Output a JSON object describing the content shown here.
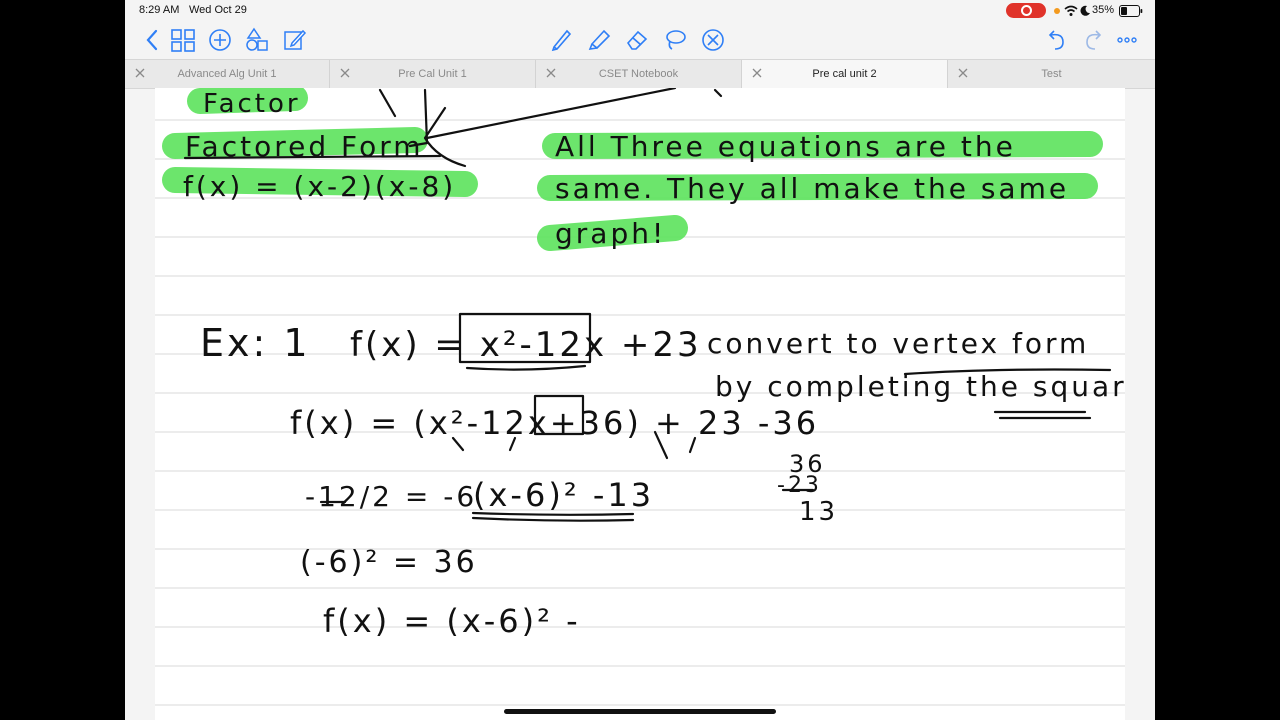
{
  "status": {
    "time": "8:29 AM",
    "date": "Wed Oct 29",
    "battery": "35%"
  },
  "toolbar": {
    "left_icons": [
      "back-chevron-icon",
      "thumbnails-grid-icon",
      "add-circle-icon",
      "shapes-icon",
      "edit-document-icon"
    ],
    "center_tools": [
      "pen-icon",
      "highlighter-icon",
      "eraser-icon",
      "lasso-icon",
      "close-tools-icon"
    ],
    "right_icons": [
      "undo-icon",
      "redo-icon",
      "more-icon"
    ],
    "pen_color": "#111111",
    "highlighter_color": "#5fe35f",
    "accent": "#2f7ff6"
  },
  "tabs": [
    {
      "label": "Advanced Alg Unit 1",
      "active": false
    },
    {
      "label": "Pre Cal Unit 1",
      "active": false
    },
    {
      "label": "CSET Notebook",
      "active": false
    },
    {
      "label": "Pre cal unit 2",
      "active": true
    },
    {
      "label": "Test",
      "active": false
    }
  ],
  "notes": {
    "top_word": "Factor",
    "factored_form_title": "Factored Form",
    "factored_form_eq": "f(x) = (x-2)(x-8)",
    "note_line1": "All Three equations are the",
    "note_line2": "same. They all make the same",
    "note_line3": "graph!",
    "example_label": "Ex: 1",
    "ex_function": "f(x) = x²-12x +23",
    "convert_line1": "convert to vertex form",
    "convert_line2": "by completing the square",
    "step1": "f(x) = (x²-12x+36) + 23 -36",
    "half_b": "-12/2 = -6",
    "result": "(x-6)² -13",
    "square_step": "(-6)² = 36",
    "final_partial": "f(x) = (x-6)² -",
    "side_calc_top": "36",
    "side_calc_mid": "-23",
    "side_calc_result": "13"
  }
}
